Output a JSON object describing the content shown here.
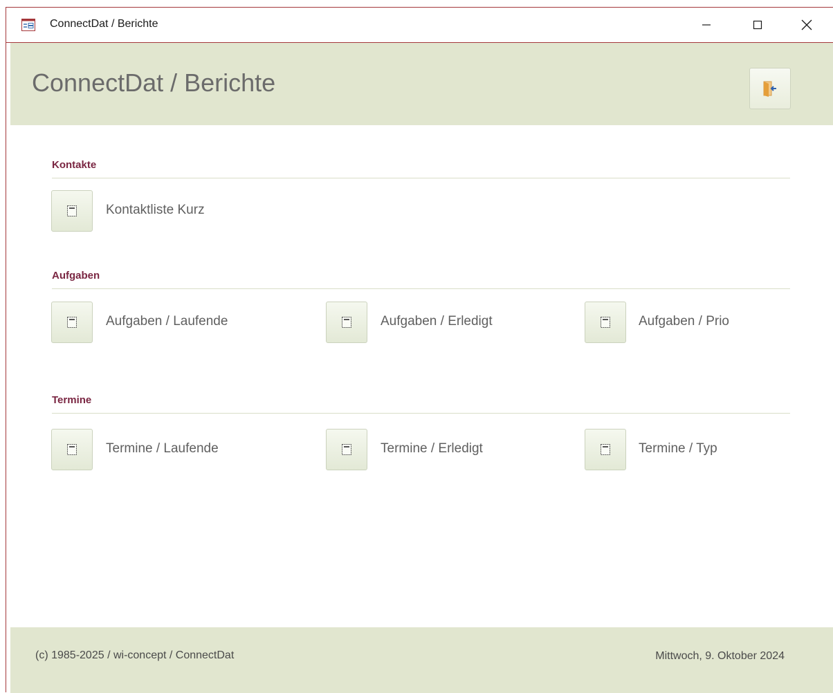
{
  "window": {
    "title": "ConnectDat / Berichte",
    "icon": "form-icon",
    "controls": [
      "minimize-icon",
      "maximize-icon",
      "close-icon"
    ]
  },
  "header": {
    "title": "ConnectDat / Berichte",
    "exit_icon": "exit-door-icon"
  },
  "sections": [
    {
      "title": "Kontakte",
      "items": [
        {
          "label": "Kontaktliste Kurz",
          "icon": "report-icon"
        }
      ]
    },
    {
      "title": "Aufgaben",
      "items": [
        {
          "label": "Aufgaben / Laufende",
          "icon": "report-icon"
        },
        {
          "label": "Aufgaben / Erledigt",
          "icon": "report-icon"
        },
        {
          "label": "Aufgaben / Prio",
          "icon": "report-icon"
        }
      ]
    },
    {
      "title": "Termine",
      "items": [
        {
          "label": "Termine / Laufende",
          "icon": "report-icon"
        },
        {
          "label": "Termine / Erledigt",
          "icon": "report-icon"
        },
        {
          "label": "Termine / Typ",
          "icon": "report-icon"
        }
      ]
    }
  ],
  "footer": {
    "copyright": "(c) 1985-2025 / wi-concept / ConnectDat",
    "date": "Mittwoch, 9. Oktober 2024"
  },
  "colors": {
    "header_bg": "#e1e6cf",
    "section_title": "#7a2642",
    "window_border": "#a4373a"
  }
}
